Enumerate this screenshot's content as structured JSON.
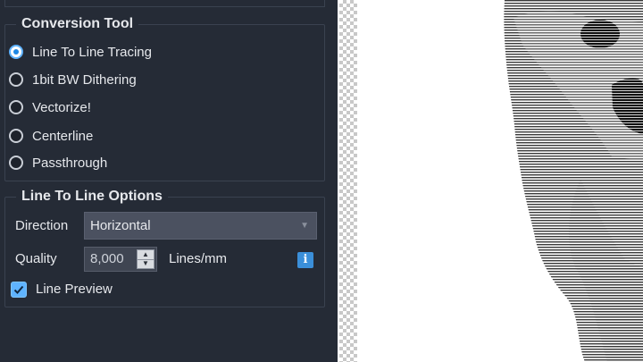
{
  "conversion_tool": {
    "title": "Conversion Tool",
    "options": [
      {
        "label": "Line To Line Tracing",
        "selected": true
      },
      {
        "label": "1bit BW Dithering",
        "selected": false
      },
      {
        "label": "Vectorize!",
        "selected": false
      },
      {
        "label": "Centerline",
        "selected": false
      },
      {
        "label": "Passthrough",
        "selected": false
      }
    ]
  },
  "line_options": {
    "title": "Line To Line Options",
    "direction_label": "Direction",
    "direction_value": "Horizontal",
    "quality_label": "Quality",
    "quality_value": "8,000",
    "quality_unit": "Lines/mm",
    "info_glyph": "i",
    "preview_label": "Line Preview",
    "preview_checked": true
  },
  "colors": {
    "panel": "#252b36",
    "accent": "#5fb3ff",
    "info": "#3b8fd9"
  }
}
